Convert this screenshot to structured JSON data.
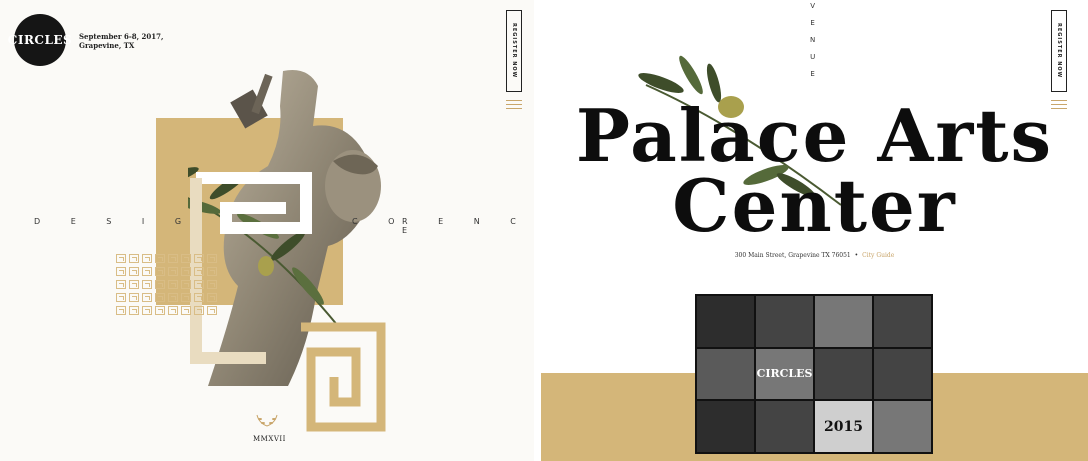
{
  "left": {
    "logo_text": "CIRCLES",
    "event_date_line1": "September 6-8, 2017,",
    "event_date_line2": "Grapevine, TX",
    "register_label": "REGISTER NOW",
    "tagline_left": "D E S I G",
    "tagline_mid": "C O",
    "tagline_right": "R E N C E",
    "year": "MMXVII"
  },
  "right": {
    "venue_letters": [
      "V",
      "E",
      "N",
      "U",
      "E"
    ],
    "register_label": "REGISTER NOW",
    "title_line1": "Palace Arts",
    "title_line2": "Center",
    "address": "300 Main Street, Grapevine TX 76051",
    "address_separator": "•",
    "city_guide": "City Guide",
    "collage_sign": "CIRCLES",
    "collage_year": "2015"
  },
  "colors": {
    "gold": "#d4b679",
    "dark": "#151515",
    "link": "#c8a468"
  },
  "icons": [
    "menu-icon",
    "laurel-icon",
    "meander-pattern-icon"
  ]
}
